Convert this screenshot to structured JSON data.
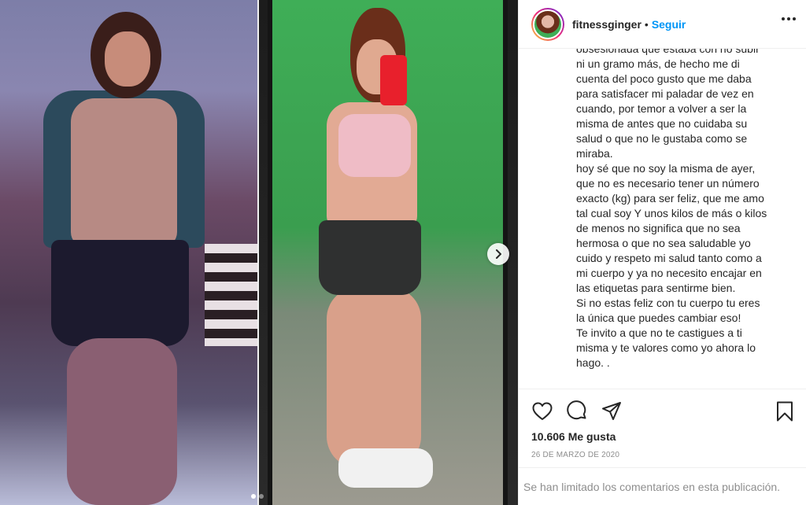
{
  "header": {
    "username": "fitnessginger",
    "separator": "•",
    "follow_label": "Seguir"
  },
  "caption": {
    "lines": [
      "obsesionada que estaba con no subir",
      "ni un gramo más, de hecho me di",
      "cuenta del poco gusto que me daba",
      "para satisfacer mi paladar de vez en",
      "cuando, por temor a volver a ser la",
      "misma de antes que no cuidaba su",
      "salud o que no le gustaba como se",
      "miraba.",
      "hoy sé que no soy la misma de ayer,",
      "que no es necesario tener un número",
      "exacto (kg) para ser feliz, que me amo",
      "tal cual soy Y unos kilos de más o kilos",
      "de menos no significa que no sea",
      "hermosa o que no sea saludable yo",
      "cuido y respeto mi salud tanto como a",
      "mi cuerpo y ya no necesito encajar en",
      "las etiquetas para sentirme bien.",
      "Si no estas feliz con tu cuerpo tu eres",
      "la única que puedes cambiar eso!",
      "Te invito a que no te castigues a ti",
      "misma y te valores como yo ahora lo",
      "hago. ."
    ]
  },
  "stats": {
    "likes": "10.606 Me gusta",
    "date": "26 DE MARZO DE 2020"
  },
  "comments": {
    "limited_note": "Se han limitado los comentarios en esta publicación."
  },
  "icons": {
    "like": "heart-icon",
    "comment": "comment-icon",
    "share": "share-icon",
    "save": "bookmark-icon",
    "next": "chevron-right-icon",
    "more": "more-options-icon"
  },
  "colors": {
    "follow": "#0095f6",
    "muted": "#8e8e8e",
    "text": "#262626"
  }
}
